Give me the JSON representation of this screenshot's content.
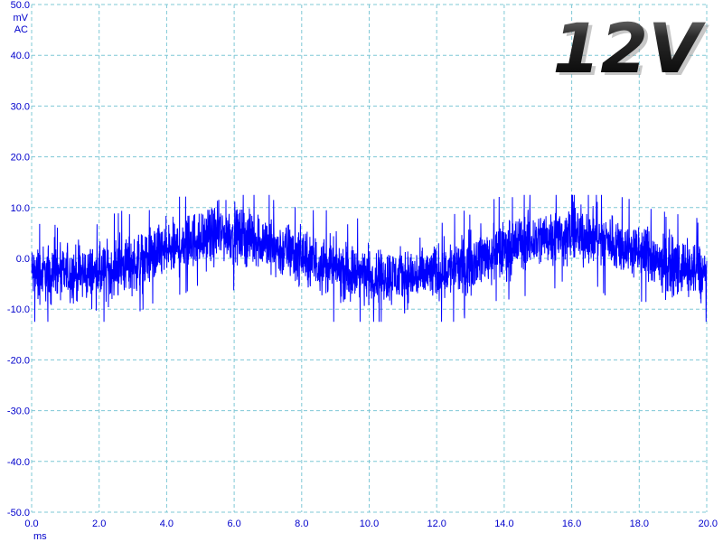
{
  "chart_data": {
    "type": "line",
    "y_unit": "mV",
    "coupling": "AC",
    "x_unit": "ms",
    "xlim": [
      0.0,
      20.0
    ],
    "ylim": [
      -50.0,
      50.0
    ],
    "x_ticks": [
      0.0,
      2.0,
      4.0,
      6.0,
      8.0,
      10.0,
      12.0,
      14.0,
      16.0,
      18.0,
      20.0
    ],
    "x_tick_labels": [
      "0.0",
      "2.0",
      "4.0",
      "6.0",
      "8.0",
      "10.0",
      "12.0",
      "14.0",
      "16.0",
      "18.0",
      "20.0"
    ],
    "y_ticks": [
      50.0,
      40.0,
      30.0,
      20.0,
      10.0,
      0.0,
      -10.0,
      -20.0,
      -30.0,
      -40.0,
      -50.0
    ],
    "y_tick_labels": [
      "50.0",
      "40.0",
      "30.0",
      "20.0",
      "10.0",
      "0.0",
      "-10.0",
      "-20.0",
      "-30.0",
      "-40.0",
      "-50.0"
    ],
    "grid": true,
    "series": [
      {
        "color": "#0000ff",
        "envelope_center": {
          "x": [
            0.0,
            1.0,
            2.0,
            3.0,
            4.0,
            5.0,
            5.7,
            6.5,
            7.5,
            8.5,
            9.5,
            10.5,
            11.5,
            12.5,
            13.5,
            14.5,
            15.5,
            16.2,
            17.0,
            18.0,
            19.0,
            20.0
          ],
          "y": [
            -3.0,
            -3.0,
            -3.0,
            -1.0,
            1.5,
            4.0,
            5.0,
            4.0,
            1.5,
            -1.0,
            -3.0,
            -3.5,
            -3.5,
            -2.0,
            0.5,
            3.0,
            4.5,
            4.5,
            3.5,
            1.0,
            -1.5,
            -3.0
          ]
        },
        "envelope_peak_to_peak": 14.0,
        "max": 12.5,
        "min": -12.5
      }
    ],
    "badge": {
      "text": "12V",
      "color": "#000000"
    }
  }
}
